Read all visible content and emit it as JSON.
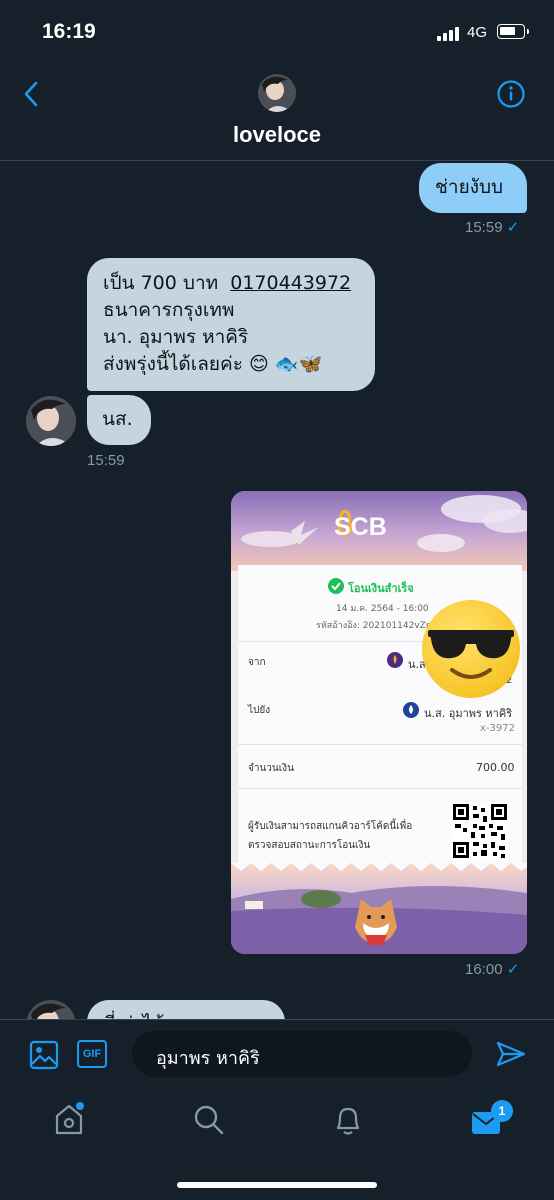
{
  "status_bar": {
    "time": "16:19",
    "network": "4G"
  },
  "header": {
    "username": "loveloce"
  },
  "messages": [
    {
      "id": "m1",
      "direction": "outgoing",
      "text": "ช่ายงับบ",
      "time": "15:59",
      "read_mark": "✓"
    },
    {
      "id": "m2",
      "direction": "incoming",
      "lines": [
        "เป็น 700 บาท",
        "0170443972",
        "ธนาคารกรุงเทพ",
        "นา. อุมาพร หาคิริ",
        "ส่งพรุ่งนี้ได้เลยค่ะ 😊 🐟🦋"
      ]
    },
    {
      "id": "m3",
      "direction": "incoming",
      "text": "นส.",
      "time": "15:59"
    },
    {
      "id": "m4",
      "direction": "outgoing",
      "type": "image",
      "time": "16:00",
      "read_mark": "✓"
    }
  ],
  "receipt": {
    "brand": "SCB",
    "status": "โอนเงินสำเร็จ",
    "datetime": "14 ม.ค. 2564 - 16:00",
    "ref_label": "รหัสอ้างอิง: 202101142vZpQ8NBX",
    "from_label": "จาก",
    "from_name": "น.ส",
    "from_acct": "2",
    "to_label": "ไปยัง",
    "to_name": "น.ส. อุมาพร หาคิริ",
    "to_acct": "x-3972",
    "amount_label": "จำนวนเงิน",
    "amount": "700.00",
    "qr_note_1": "ผู้รับเงินสามารถสแกนคิวอาร์โค้ดนี้เพื่อ",
    "qr_note_2": "ตรวจสอบสถานะการโอนเงิน"
  },
  "partial_message": {
    "text": "ที่ ส่งได้ ... ะคะ"
  },
  "compose": {
    "value": "อุมาพร หาคิริ"
  },
  "toolbar": {
    "gif_label": "GIF"
  },
  "tab_bar": {
    "messages_badge": "1"
  },
  "colors": {
    "background": "#15202b",
    "accent": "#1d9bf0",
    "outgoing_bubble": "#8ecdf8",
    "incoming_bubble": "#c5d5e0"
  }
}
